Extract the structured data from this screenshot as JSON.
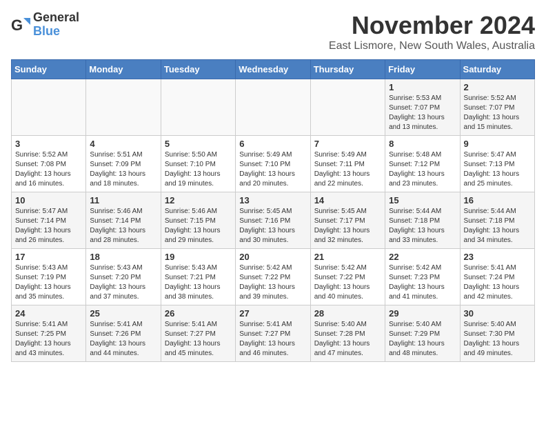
{
  "logo": {
    "general": "General",
    "blue": "Blue"
  },
  "title": "November 2024",
  "location": "East Lismore, New South Wales, Australia",
  "days_header": [
    "Sunday",
    "Monday",
    "Tuesday",
    "Wednesday",
    "Thursday",
    "Friday",
    "Saturday"
  ],
  "weeks": [
    [
      {
        "day": "",
        "info": ""
      },
      {
        "day": "",
        "info": ""
      },
      {
        "day": "",
        "info": ""
      },
      {
        "day": "",
        "info": ""
      },
      {
        "day": "",
        "info": ""
      },
      {
        "day": "1",
        "info": "Sunrise: 5:53 AM\nSunset: 7:07 PM\nDaylight: 13 hours\nand 13 minutes."
      },
      {
        "day": "2",
        "info": "Sunrise: 5:52 AM\nSunset: 7:07 PM\nDaylight: 13 hours\nand 15 minutes."
      }
    ],
    [
      {
        "day": "3",
        "info": "Sunrise: 5:52 AM\nSunset: 7:08 PM\nDaylight: 13 hours\nand 16 minutes."
      },
      {
        "day": "4",
        "info": "Sunrise: 5:51 AM\nSunset: 7:09 PM\nDaylight: 13 hours\nand 18 minutes."
      },
      {
        "day": "5",
        "info": "Sunrise: 5:50 AM\nSunset: 7:10 PM\nDaylight: 13 hours\nand 19 minutes."
      },
      {
        "day": "6",
        "info": "Sunrise: 5:49 AM\nSunset: 7:10 PM\nDaylight: 13 hours\nand 20 minutes."
      },
      {
        "day": "7",
        "info": "Sunrise: 5:49 AM\nSunset: 7:11 PM\nDaylight: 13 hours\nand 22 minutes."
      },
      {
        "day": "8",
        "info": "Sunrise: 5:48 AM\nSunset: 7:12 PM\nDaylight: 13 hours\nand 23 minutes."
      },
      {
        "day": "9",
        "info": "Sunrise: 5:47 AM\nSunset: 7:13 PM\nDaylight: 13 hours\nand 25 minutes."
      }
    ],
    [
      {
        "day": "10",
        "info": "Sunrise: 5:47 AM\nSunset: 7:14 PM\nDaylight: 13 hours\nand 26 minutes."
      },
      {
        "day": "11",
        "info": "Sunrise: 5:46 AM\nSunset: 7:14 PM\nDaylight: 13 hours\nand 28 minutes."
      },
      {
        "day": "12",
        "info": "Sunrise: 5:46 AM\nSunset: 7:15 PM\nDaylight: 13 hours\nand 29 minutes."
      },
      {
        "day": "13",
        "info": "Sunrise: 5:45 AM\nSunset: 7:16 PM\nDaylight: 13 hours\nand 30 minutes."
      },
      {
        "day": "14",
        "info": "Sunrise: 5:45 AM\nSunset: 7:17 PM\nDaylight: 13 hours\nand 32 minutes."
      },
      {
        "day": "15",
        "info": "Sunrise: 5:44 AM\nSunset: 7:18 PM\nDaylight: 13 hours\nand 33 minutes."
      },
      {
        "day": "16",
        "info": "Sunrise: 5:44 AM\nSunset: 7:18 PM\nDaylight: 13 hours\nand 34 minutes."
      }
    ],
    [
      {
        "day": "17",
        "info": "Sunrise: 5:43 AM\nSunset: 7:19 PM\nDaylight: 13 hours\nand 35 minutes."
      },
      {
        "day": "18",
        "info": "Sunrise: 5:43 AM\nSunset: 7:20 PM\nDaylight: 13 hours\nand 37 minutes."
      },
      {
        "day": "19",
        "info": "Sunrise: 5:43 AM\nSunset: 7:21 PM\nDaylight: 13 hours\nand 38 minutes."
      },
      {
        "day": "20",
        "info": "Sunrise: 5:42 AM\nSunset: 7:22 PM\nDaylight: 13 hours\nand 39 minutes."
      },
      {
        "day": "21",
        "info": "Sunrise: 5:42 AM\nSunset: 7:22 PM\nDaylight: 13 hours\nand 40 minutes."
      },
      {
        "day": "22",
        "info": "Sunrise: 5:42 AM\nSunset: 7:23 PM\nDaylight: 13 hours\nand 41 minutes."
      },
      {
        "day": "23",
        "info": "Sunrise: 5:41 AM\nSunset: 7:24 PM\nDaylight: 13 hours\nand 42 minutes."
      }
    ],
    [
      {
        "day": "24",
        "info": "Sunrise: 5:41 AM\nSunset: 7:25 PM\nDaylight: 13 hours\nand 43 minutes."
      },
      {
        "day": "25",
        "info": "Sunrise: 5:41 AM\nSunset: 7:26 PM\nDaylight: 13 hours\nand 44 minutes."
      },
      {
        "day": "26",
        "info": "Sunrise: 5:41 AM\nSunset: 7:27 PM\nDaylight: 13 hours\nand 45 minutes."
      },
      {
        "day": "27",
        "info": "Sunrise: 5:41 AM\nSunset: 7:27 PM\nDaylight: 13 hours\nand 46 minutes."
      },
      {
        "day": "28",
        "info": "Sunrise: 5:40 AM\nSunset: 7:28 PM\nDaylight: 13 hours\nand 47 minutes."
      },
      {
        "day": "29",
        "info": "Sunrise: 5:40 AM\nSunset: 7:29 PM\nDaylight: 13 hours\nand 48 minutes."
      },
      {
        "day": "30",
        "info": "Sunrise: 5:40 AM\nSunset: 7:30 PM\nDaylight: 13 hours\nand 49 minutes."
      }
    ]
  ]
}
